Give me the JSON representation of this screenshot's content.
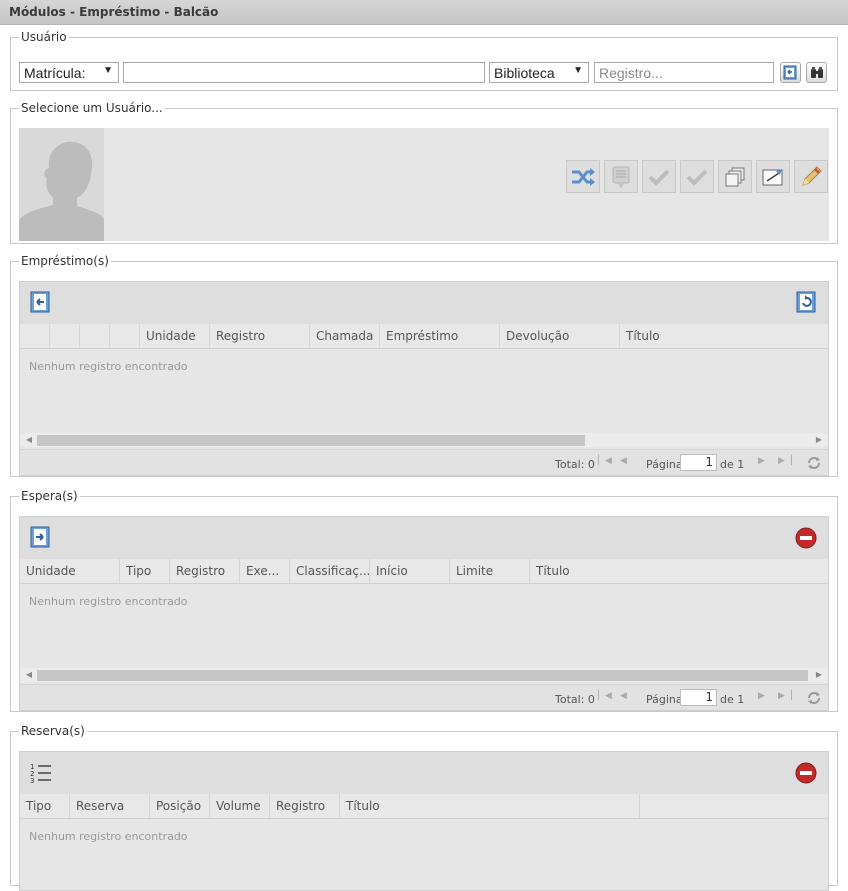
{
  "window": {
    "title": "Módulos - Empréstimo - Balcão"
  },
  "usuario": {
    "legend": "Usuário",
    "id_type": "Matrícula:",
    "search_value": "",
    "library": "Biblioteca",
    "registro_placeholder": "Registro...",
    "buttons": [
      "book-return-icon",
      "binoculars-icon"
    ]
  },
  "selected_user": {
    "legend": "Selecione um Usuário...",
    "actions": [
      "shuffle-icon",
      "notes-icon",
      "check-icon",
      "check-icon",
      "copies-icon",
      "edit-board-icon",
      "pencil-icon"
    ]
  },
  "emprestimos": {
    "legend": "Empréstimo(s)",
    "columns": [
      "",
      "",
      "",
      "",
      "Unidade",
      "Registro",
      "Chamada",
      "Empréstimo",
      "Devolução",
      "Título"
    ],
    "empty_text": "Nenhum registro encontrado",
    "pager": {
      "total": "Total: 0",
      "page_label": "Página",
      "page": "1",
      "of": "de 1"
    }
  },
  "esperas": {
    "legend": "Espera(s)",
    "columns": [
      "Unidade",
      "Tipo",
      "Registro",
      "Exe...",
      "Classificaç...",
      "Início",
      "Limite",
      "Título"
    ],
    "empty_text": "Nenhum registro encontrado",
    "pager": {
      "total": "Total: 0",
      "page_label": "Página",
      "page": "1",
      "of": "de 1"
    }
  },
  "reservas": {
    "legend": "Reserva(s)",
    "columns": [
      "Tipo",
      "Reserva",
      "Posição",
      "Volume",
      "Registro",
      "Título"
    ],
    "empty_text": "Nenhum registro encontrado"
  },
  "colors": {
    "accent": "#c22a2a",
    "panel": "#e6e6e6",
    "toolbar": "#dedede"
  }
}
